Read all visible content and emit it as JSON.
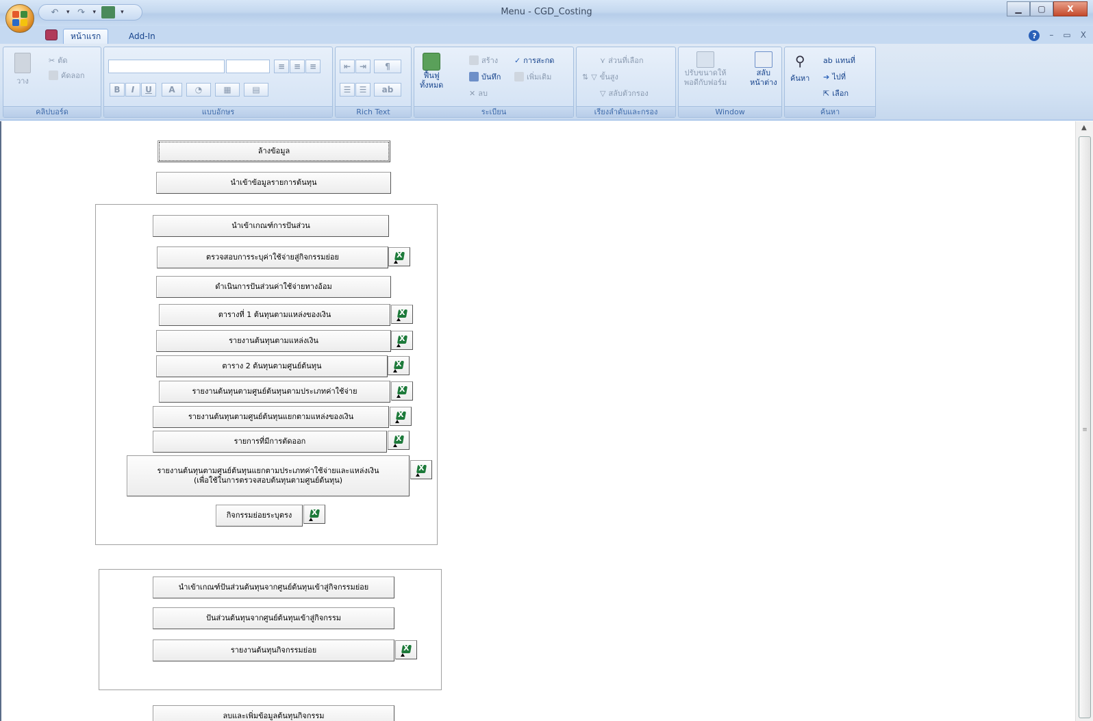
{
  "window": {
    "title": "Menu - CGD_Costing"
  },
  "tabs": {
    "home": "หน้าแรก",
    "addin": "Add-In"
  },
  "ribbon": {
    "clipboard": {
      "label": "คลิปบอร์ด",
      "paste": "วาง",
      "cut": "ตัด",
      "copy": "คัดลอก"
    },
    "font": {
      "label": "แบบอักษร",
      "bold": "B",
      "italic": "I",
      "underline": "U",
      "fontcolor": "A"
    },
    "richtext": {
      "label": "Rich Text"
    },
    "records": {
      "label": "ระเบียน",
      "refresh": "ฟื้นฟู",
      "refresh2": "ทั้งหมด",
      "new": "สร้าง",
      "save": "บันทึก",
      "delete": "ลบ",
      "spelling": "การสะกด",
      "more": "เพิ่มเติม"
    },
    "sort": {
      "label": "เรียงลำดับและกรอง",
      "selection": "ส่วนที่เลือก",
      "advanced": "ขั้นสูง",
      "toggle": "สลับตัวกรอง"
    },
    "window": {
      "label": "Window",
      "fit1": "ปรับขนาดให้",
      "fit2": "พอดีกับฟอร์ม",
      "switch1": "สลับ",
      "switch2": "หน้าต่าง"
    },
    "find": {
      "label": "ค้นหา",
      "find": "ค้นหา",
      "replace": "แทนที่",
      "goto": "ไปที่",
      "select": "เลือก"
    }
  },
  "form": {
    "btn_clear": "ล้างข้อมูล",
    "btn_import_cost": "นำเข้าข้อมูลรายการต้นทุน",
    "btn_import_alloc": "นำเข้าเกณฑ์การปันส่วน",
    "btn_check_expense": "ตรวจสอบการระบุค่าใช้จ่ายสู่กิจกรรมย่อย",
    "btn_run_indirect": "ดำเนินการปันส่วนค่าใช้จ่ายทางอ้อม",
    "btn_table1": "ตารางที่ 1 ต้นทุนตามแหล่งของเงิน",
    "btn_report_source": "รายงานต้นทุนตามแหล่งเงิน",
    "btn_table2": "ตาราง 2 ต้นทุนตามศูนย์ต้นทุน",
    "btn_report_cc_type": "รายงานต้นทุนตามศูนย์ต้นทุนตามประเภทค่าใช้จ่าย",
    "btn_report_cc_source": "รายงานต้นทุนตามศูนย์ต้นทุนแยกตามแหล่งของเงิน",
    "btn_cutoff": "รายการที่มีการตัดออก",
    "btn_report_full_line1": "รายงานต้นทุนตามศูนย์ต้นทุนแยกตามประเภทค่าใช้จ่ายและแหล่งเงิน",
    "btn_report_full_line2": "(เพื่อใช้ในการตรวจสอบต้นทุนตามศูนย์ต้นทุน)",
    "btn_direct": "กิจกรรมย่อยระบุตรง",
    "btn_import_cc_alloc": "นำเข้าเกณฑ์ปันส่วนต้นทุนจากศูนย์ต้นทุนเข้าสู่กิจกรรมย่อย",
    "btn_alloc_cc": "ปันส่วนต้นทุนจากศูนย์ต้นทุนเข้าสู่กิจกรรม",
    "btn_report_activity": "รายงานต้นทุนกิจกรรมย่อย",
    "btn_edit_activity": "ลบและเพิ่มข้อมูลต้นทุนกิจกรรม"
  }
}
